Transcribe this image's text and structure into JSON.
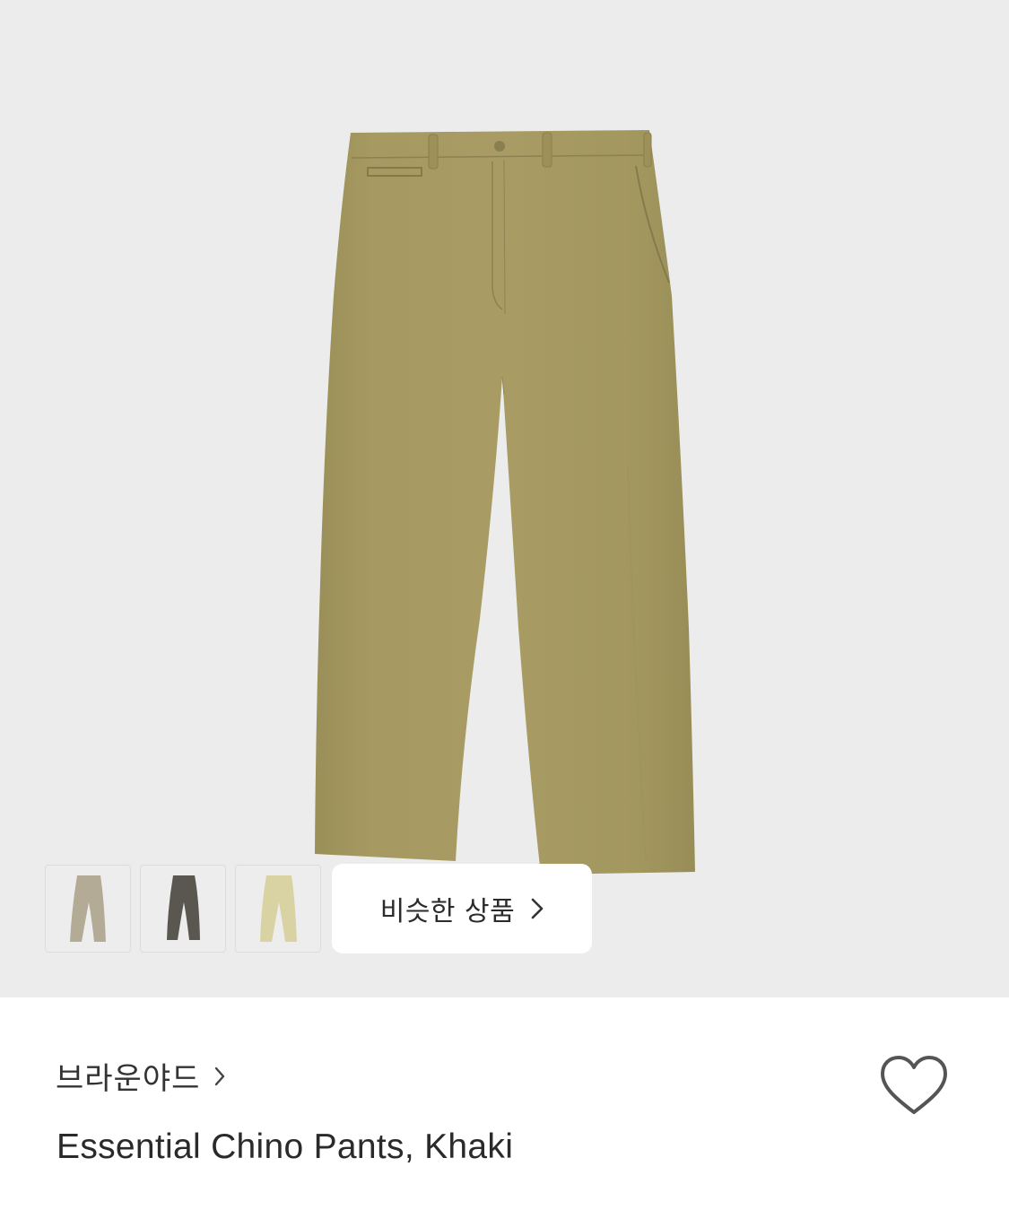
{
  "product_image": {
    "background": "#ececec",
    "garment_color": "#a69a62"
  },
  "thumbnails": [
    {
      "name": "beige",
      "color": "#b3ab95"
    },
    {
      "name": "charcoal",
      "color": "#5a5650"
    },
    {
      "name": "light-khaki",
      "color": "#d9d3a4"
    }
  ],
  "similar_button": {
    "label": "비슷한 상품",
    "icon": "chevron-right-icon"
  },
  "product": {
    "brand": "브라운야드",
    "brand_icon": "chevron-right-icon",
    "title": "Essential Chino Pants, Khaki",
    "wishlist_icon": "heart-outline-icon"
  },
  "colors": {
    "text_primary": "#2a2a2a",
    "icon_gray": "#555555"
  }
}
